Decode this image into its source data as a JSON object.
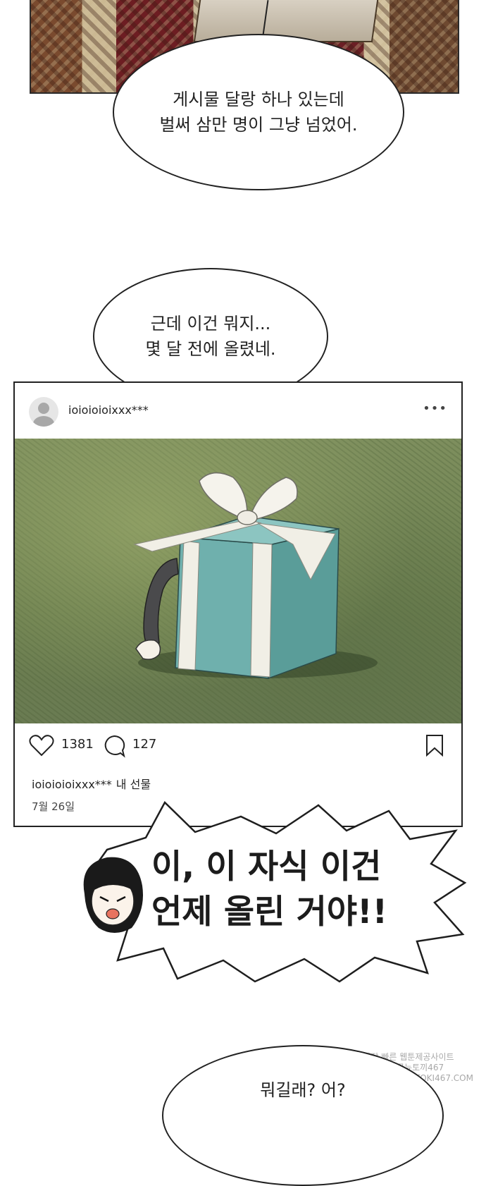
{
  "panel1": {
    "bubble_lines": [
      "게시물 달랑 하나 있는데",
      "벌써 삼만 명이 그냥 넘었어."
    ]
  },
  "panel2": {
    "bubble_lines": [
      "근데 이건 뭐지...",
      "몇 달 전에 올렸네."
    ]
  },
  "post": {
    "username": "ioioioioixxx***",
    "more_icon": "more-horizontal-icon",
    "likes": "1381",
    "comments": "127",
    "caption_user": "ioioioioixxx***",
    "caption_text": "내 선물",
    "date": "7월 26일",
    "photo_colors": {
      "grass": "#7b8c5a",
      "box": "#6fb1ae",
      "ribbon": "#f1efe6"
    }
  },
  "shout": {
    "lines": [
      "이, 이 자식 이건",
      "언제 올린 거야!!"
    ]
  },
  "panel4": {
    "bubble_lines": [
      "뭐길래? 어?"
    ]
  },
  "watermark": {
    "lines": [
      "가장 빠른 웹툰제공사이트",
      "웹툰왕국뉴토끼467",
      "HTTPS://NEWTOKI467.COM"
    ]
  }
}
